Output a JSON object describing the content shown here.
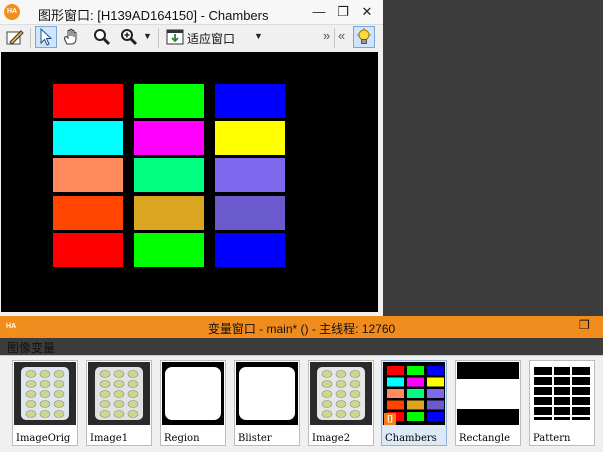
{
  "graphics_window": {
    "title": "图形窗口: [H139AD164150] - Chambers",
    "logo_text": "HA",
    "toolbar": {
      "zoom_mode": "适应窗口",
      "overflow": "»",
      "collapse": "«"
    },
    "icons": [
      "draw-icon",
      "pointer-icon",
      "hand-pan-icon",
      "magnifier-icon",
      "zoom-in-icon",
      "fit-window-icon",
      "lightbulb-icon"
    ]
  },
  "variable_window": {
    "title": "变量窗口 - main* () - 主线程: 12760",
    "logo_text": "HA",
    "section_label": "图像变量",
    "variables": [
      {
        "name": "ImageOrig",
        "selected": false
      },
      {
        "name": "Image1",
        "selected": false
      },
      {
        "name": "Region",
        "selected": false
      },
      {
        "name": "Blister",
        "selected": false
      },
      {
        "name": "Image2",
        "selected": false
      },
      {
        "name": "Chambers",
        "selected": true,
        "badge": "[]"
      },
      {
        "name": "Rectangle",
        "selected": false
      },
      {
        "name": "Pattern",
        "selected": false
      }
    ]
  },
  "colors": {
    "accent_orange": "#f08c1e",
    "chamber_colors": [
      [
        "#ff0000",
        "#00ff00",
        "#0000ff"
      ],
      [
        "#00ffff",
        "#ff00ff",
        "#ffff00"
      ],
      [
        "#ff8a5c",
        "#00ff80",
        "#7e68ee"
      ],
      [
        "#ff4500",
        "#daa520",
        "#6a5acd"
      ],
      [
        "#ff0000",
        "#00ff00",
        "#0000ff"
      ]
    ]
  }
}
